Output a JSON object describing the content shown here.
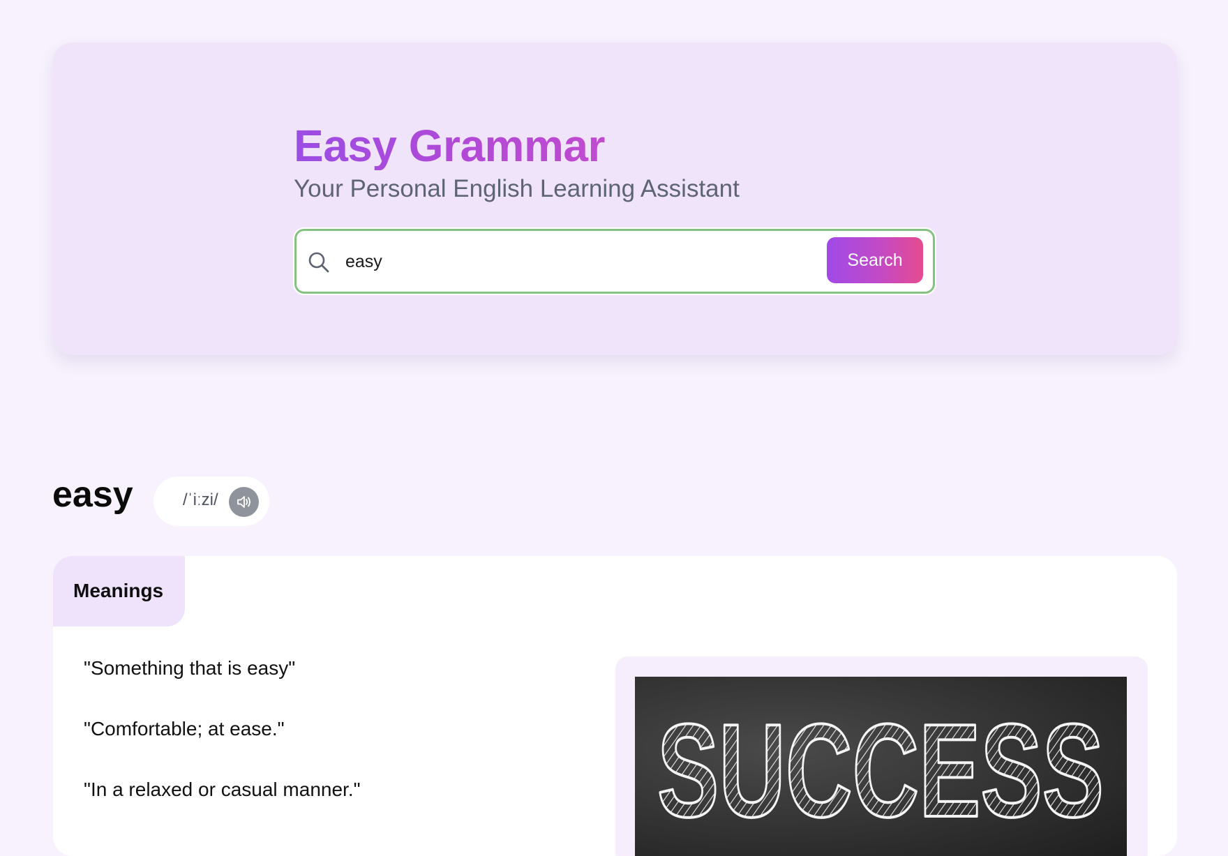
{
  "header": {
    "title": "Easy Grammar",
    "subtitle": "Your Personal English Learning Assistant"
  },
  "search": {
    "value": "easy",
    "placeholder": "",
    "button_label": "Search",
    "icon": "search-icon"
  },
  "word": {
    "text": "easy",
    "pronunciation": "/ˈiːzi/",
    "audio_icon": "speaker-icon"
  },
  "meanings_tab": {
    "label": "Meanings",
    "items": [
      "\"Something that is easy\"",
      "\"Comfortable; at ease.\"",
      "\"In a relaxed or casual manner.\""
    ]
  },
  "image": {
    "chalk_text": "SUCCESS"
  },
  "colors": {
    "background": "#f7f2fd",
    "hero_background": "#f0e4fb",
    "accent_gradient_start": "#a04ae8",
    "accent_gradient_end": "#e64b8f",
    "search_border": "#86c184",
    "audio_button": "#8f949c"
  }
}
